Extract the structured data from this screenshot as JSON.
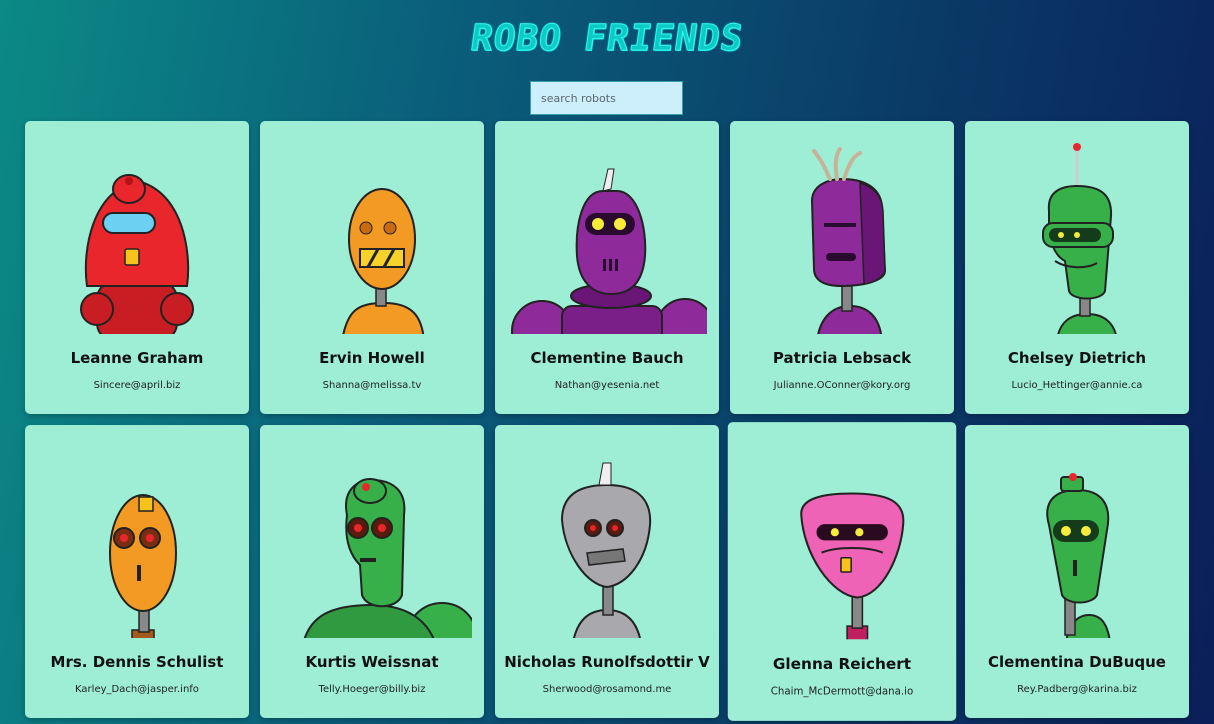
{
  "app": {
    "title": "ROBO FRIENDS",
    "search_placeholder": "search robots"
  },
  "robots": [
    {
      "name": "Leanne Graham",
      "email": "Sincere@april.biz",
      "color": "#e8262b",
      "icon": "red-robot-icon"
    },
    {
      "name": "Ervin Howell",
      "email": "Shanna@melissa.tv",
      "color": "#f39a24",
      "icon": "orange-robot-icon"
    },
    {
      "name": "Clementine Bauch",
      "email": "Nathan@yesenia.net",
      "color": "#8e2a9a",
      "icon": "purple-robot-icon"
    },
    {
      "name": "Patricia Lebsack",
      "email": "Julianne.OConner@kory.org",
      "color": "#8e2a9a",
      "icon": "purple-robot-icon"
    },
    {
      "name": "Chelsey Dietrich",
      "email": "Lucio_Hettinger@annie.ca",
      "color": "#38b04a",
      "icon": "green-robot-icon"
    },
    {
      "name": "Mrs. Dennis Schulist",
      "email": "Karley_Dach@jasper.info",
      "color": "#f39a24",
      "icon": "orange-robot-icon"
    },
    {
      "name": "Kurtis Weissnat",
      "email": "Telly.Hoeger@billy.biz",
      "color": "#38b04a",
      "icon": "green-robot-icon"
    },
    {
      "name": "Nicholas Runolfsdottir V",
      "email": "Sherwood@rosamond.me",
      "color": "#a9a9ad",
      "icon": "gray-robot-icon"
    },
    {
      "name": "Glenna Reichert",
      "email": "Chaim_McDermott@dana.io",
      "color": "#ee63b5",
      "icon": "pink-robot-icon"
    },
    {
      "name": "Clementina DuBuque",
      "email": "Rey.Padberg@karina.biz",
      "color": "#38b04a",
      "icon": "green-robot-icon"
    }
  ]
}
